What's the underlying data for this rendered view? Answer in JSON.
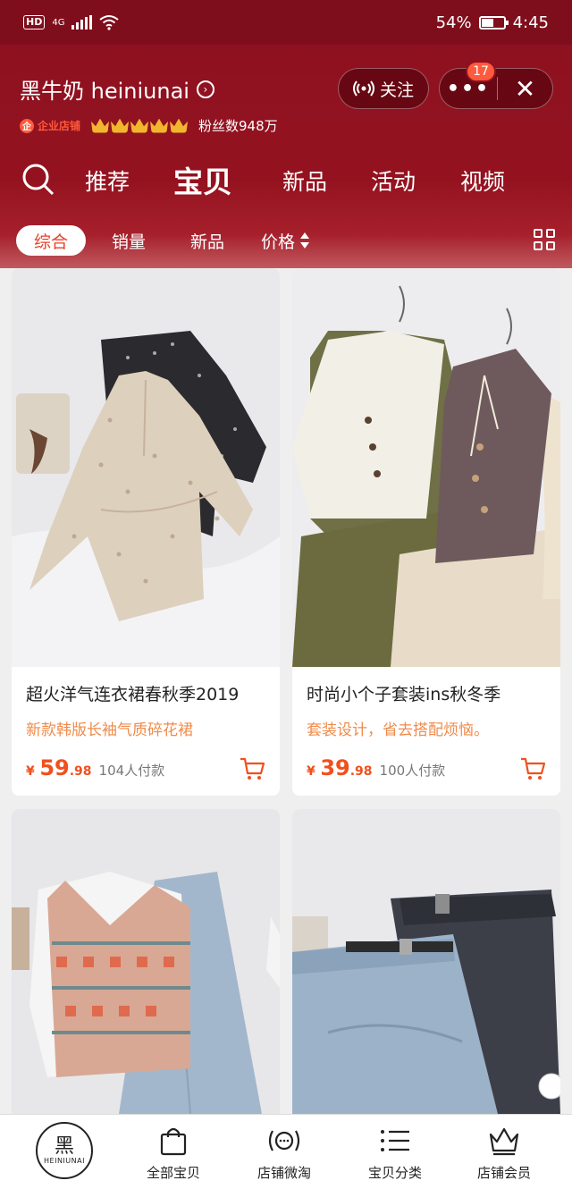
{
  "status_bar": {
    "network": "4G",
    "battery": "54%",
    "battery_level": 0.54,
    "time": "4:45"
  },
  "shop": {
    "name": "黑牛奶 heiniunai",
    "enterprise_badge": "企业店铺",
    "crown_count": 5,
    "fans": "粉丝数948万",
    "follow_label": "关注",
    "notification_count": "17"
  },
  "tabs": [
    {
      "label": "推荐",
      "active": false
    },
    {
      "label": "宝贝",
      "active": true
    },
    {
      "label": "新品",
      "active": false
    },
    {
      "label": "活动",
      "active": false
    },
    {
      "label": "视频",
      "active": false
    }
  ],
  "filters": [
    {
      "label": "综合",
      "active": true
    },
    {
      "label": "销量",
      "active": false
    },
    {
      "label": "新品",
      "active": false
    },
    {
      "label": "价格",
      "active": false
    }
  ],
  "products": [
    {
      "title": "超火洋气连衣裙春秋季2019",
      "subtitle": "新款韩版长袖气质碎花裙",
      "currency": "¥",
      "price_int": "59",
      "price_dec": ".98",
      "sold": "104人付款"
    },
    {
      "title": "时尚小个子套装ins秋冬季",
      "subtitle": "套装设计，省去搭配烦恼。",
      "currency": "¥",
      "price_int": "39",
      "price_dec": ".98",
      "sold": "100人付款"
    },
    {
      "title": "",
      "subtitle": "",
      "currency": "",
      "price_int": "",
      "price_dec": "",
      "sold": ""
    },
    {
      "title": "",
      "subtitle": "",
      "currency": "",
      "price_int": "",
      "price_dec": "",
      "sold": ""
    }
  ],
  "bottom_nav": {
    "logo_zh": "黑",
    "logo_en": "HEINIUNAI",
    "items": [
      {
        "label": "全部宝贝",
        "icon": "shopping-bag-icon"
      },
      {
        "label": "店铺微淘",
        "icon": "broadcast-chat-icon"
      },
      {
        "label": "宝贝分类",
        "icon": "list-icon"
      },
      {
        "label": "店铺会员",
        "icon": "crown-icon"
      }
    ]
  },
  "colors": {
    "brand_red": "#8e1120",
    "price_orange": "#f0501e",
    "subtitle_orange": "#f08b4a"
  }
}
